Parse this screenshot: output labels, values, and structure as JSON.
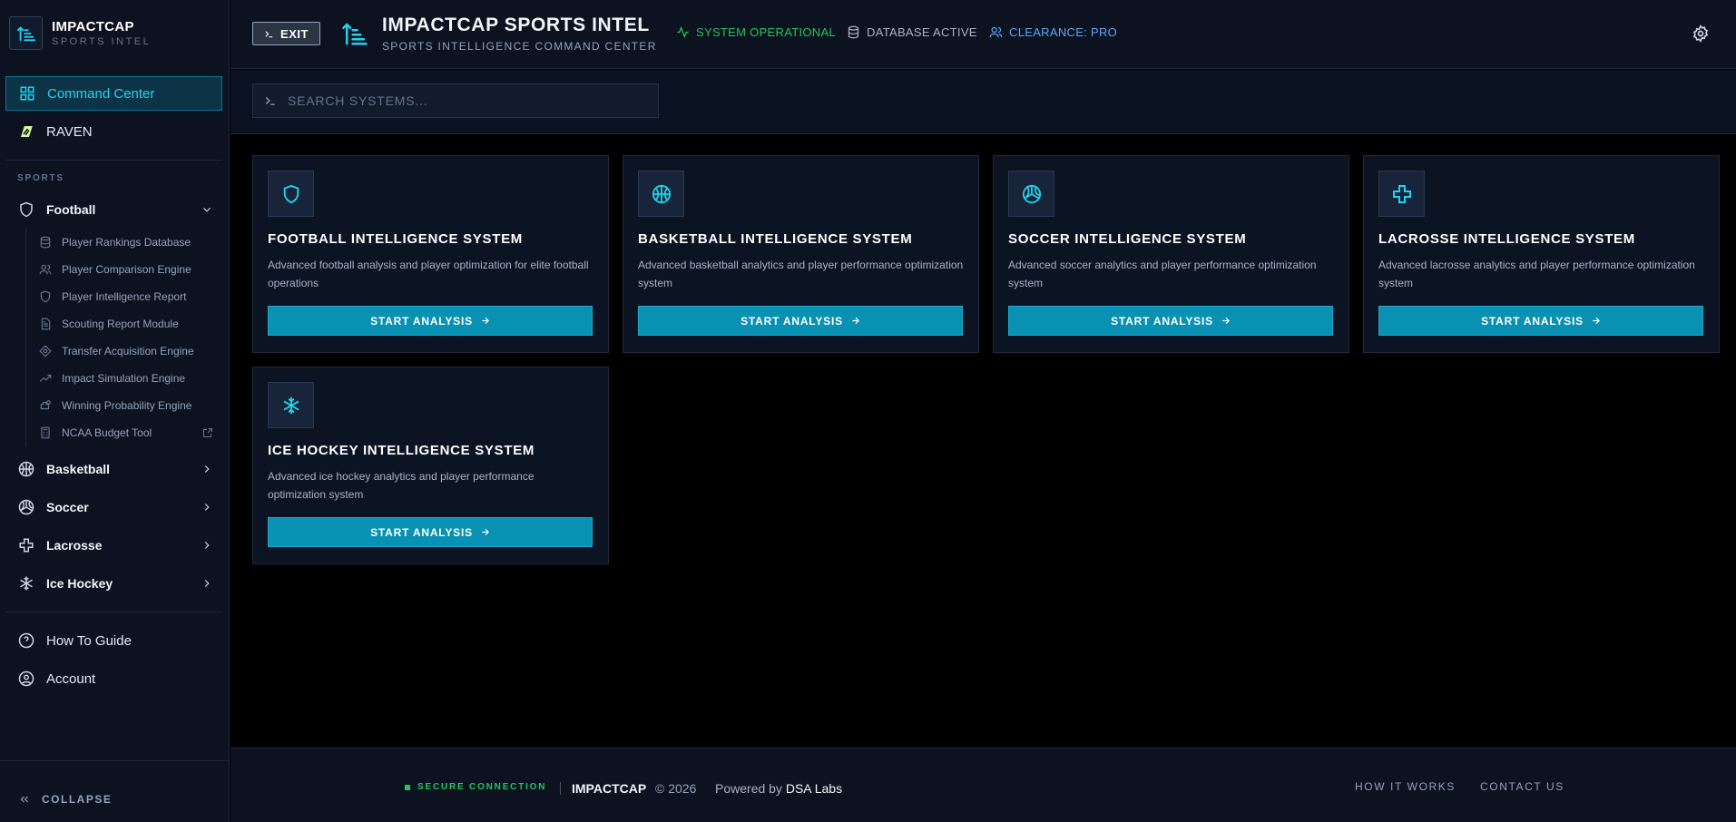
{
  "brand": {
    "title": "IMPACTCAP",
    "subtitle": "SPORTS INTEL"
  },
  "nav": {
    "command_center": "Command Center",
    "raven": "RAVEN",
    "sports_label": "SPORTS",
    "how_to": "How To Guide",
    "account": "Account",
    "collapse": "COLLAPSE"
  },
  "sports": {
    "football": "Football",
    "basketball": "Basketball",
    "soccer": "Soccer",
    "lacrosse": "Lacrosse",
    "ice_hockey": "Ice Hockey"
  },
  "football_tools": [
    "Player Rankings Database",
    "Player Comparison Engine",
    "Player Intelligence Report",
    "Scouting Report Module",
    "Transfer Acquisition Engine",
    "Impact Simulation Engine",
    "Winning Probability Engine",
    "NCAA Budget Tool"
  ],
  "topbar": {
    "exit": "EXIT",
    "title": "IMPACTCAP SPORTS INTEL",
    "subtitle": "SPORTS INTELLIGENCE COMMAND CENTER",
    "status_system": "SYSTEM OPERATIONAL",
    "status_db": "DATABASE ACTIVE",
    "status_clearance": "CLEARANCE: PRO"
  },
  "search": {
    "placeholder": "SEARCH SYSTEMS..."
  },
  "cards": [
    {
      "title": "FOOTBALL INTELLIGENCE SYSTEM",
      "desc": "Advanced football analysis and player optimization for elite football operations",
      "button": "START ANALYSIS"
    },
    {
      "title": "BASKETBALL INTELLIGENCE SYSTEM",
      "desc": "Advanced basketball analytics and player performance optimization system",
      "button": "START ANALYSIS"
    },
    {
      "title": "SOCCER INTELLIGENCE SYSTEM",
      "desc": "Advanced soccer analytics and player performance optimization system",
      "button": "START ANALYSIS"
    },
    {
      "title": "LACROSSE INTELLIGENCE SYSTEM",
      "desc": "Advanced lacrosse analytics and player performance optimization system",
      "button": "START ANALYSIS"
    },
    {
      "title": "ICE HOCKEY INTELLIGENCE SYSTEM",
      "desc": "Advanced ice hockey analytics and player performance optimization system",
      "button": "START ANALYSIS"
    }
  ],
  "footer": {
    "secure": "SECURE CONNECTION",
    "brand": "IMPACTCAP",
    "copyright": "© 2026",
    "powered_prefix": "Powered by",
    "powered_by": "DSA Labs",
    "how_it_works": "HOW IT WORKS",
    "contact": "CONTACT US"
  },
  "colors": {
    "accent": "#22d3ee",
    "button": "#0891b2",
    "status_ok": "#22c55e",
    "clearance": "#60a5fa",
    "background": "#000000",
    "panel": "#0c1220"
  }
}
